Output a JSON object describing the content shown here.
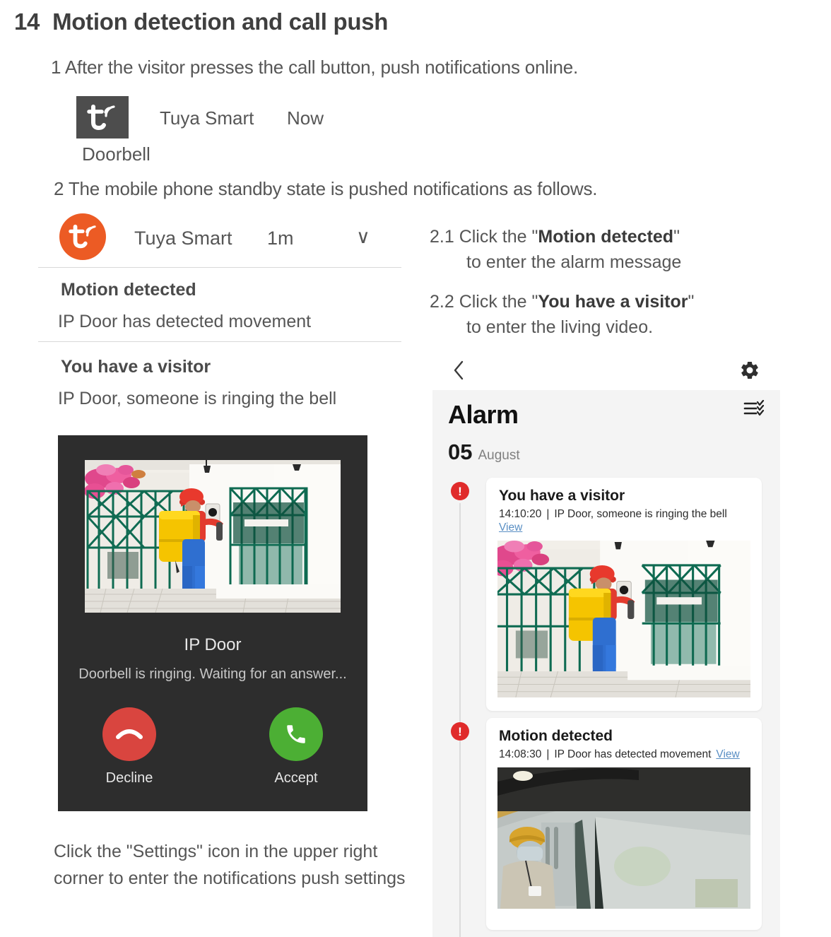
{
  "heading": {
    "number": "14",
    "title": "Motion detection and call push"
  },
  "step1": {
    "text": "1 After the visitor presses the call button, push notifications online.",
    "notification": {
      "app_icon": "tuya-app-icon",
      "app_name": "Tuya Smart",
      "time": "Now",
      "body": "Doorbell"
    }
  },
  "step2": {
    "text": "2  The mobile phone standby state is pushed notifications  as follows.",
    "notification_header": {
      "app_icon": "tuya-app-icon",
      "app_name": "Tuya Smart",
      "time": "1m",
      "expand_glyph": "∨"
    },
    "items": [
      {
        "title": "Motion detected",
        "desc": "IP Door has detected movement"
      },
      {
        "title": "You have a visitor",
        "desc": "IP Door, someone is ringing the bell"
      }
    ]
  },
  "call_screen": {
    "device_name": "IP Door",
    "status": "Doorbell is ringing. Waiting for an answer...",
    "decline_label": "Decline",
    "accept_label": "Accept",
    "decline_color": "#d9453f",
    "accept_color": "#4caf34",
    "background": "#2d2d2d"
  },
  "left_caption": "Click the \"Settings\" icon in the upper right corner to enter the notifications push settings",
  "instructions": [
    {
      "lead": "2.1 Click the \"",
      "bold": "Motion detected",
      "tail": "\"",
      "second_line": "to enter the alarm message"
    },
    {
      "lead": "2.2 Click the \"",
      "bold": "You have a visitor",
      "tail": "\"",
      "second_line": "to enter the living video."
    }
  ],
  "phone_topbar": {
    "back_icon": "back-chevron-icon",
    "settings_icon": "gear-icon"
  },
  "alarm": {
    "title": "Alarm",
    "menu_icon": "checklist-icon",
    "day": "05",
    "month": "August",
    "badge_glyph": "!",
    "cards": [
      {
        "title": "You have a visitor",
        "time": "14:10:20",
        "separator": "|",
        "desc": "IP Door, someone is ringing the bell",
        "view_label": "View",
        "view_inline": false
      },
      {
        "title": "Motion detected",
        "time": "14:08:30",
        "separator": "|",
        "desc": "IP Door has detected movement",
        "view_label": "View",
        "view_inline": true
      }
    ]
  },
  "colors": {
    "tuya_orange": "#ec5b24",
    "alarm_bg": "#f4f4f4",
    "badge_red": "#e02b2b",
    "link_blue": "#5a8fc4"
  }
}
